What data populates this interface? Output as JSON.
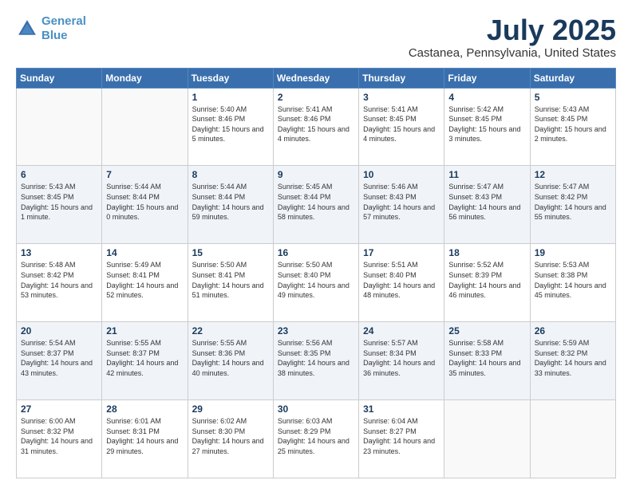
{
  "header": {
    "logo_line1": "General",
    "logo_line2": "Blue",
    "month": "July 2025",
    "location": "Castanea, Pennsylvania, United States"
  },
  "days_of_week": [
    "Sunday",
    "Monday",
    "Tuesday",
    "Wednesday",
    "Thursday",
    "Friday",
    "Saturday"
  ],
  "weeks": [
    [
      {
        "day": "",
        "empty": true
      },
      {
        "day": "",
        "empty": true
      },
      {
        "day": "1",
        "sunrise": "Sunrise: 5:40 AM",
        "sunset": "Sunset: 8:46 PM",
        "daylight": "Daylight: 15 hours and 5 minutes."
      },
      {
        "day": "2",
        "sunrise": "Sunrise: 5:41 AM",
        "sunset": "Sunset: 8:46 PM",
        "daylight": "Daylight: 15 hours and 4 minutes."
      },
      {
        "day": "3",
        "sunrise": "Sunrise: 5:41 AM",
        "sunset": "Sunset: 8:45 PM",
        "daylight": "Daylight: 15 hours and 4 minutes."
      },
      {
        "day": "4",
        "sunrise": "Sunrise: 5:42 AM",
        "sunset": "Sunset: 8:45 PM",
        "daylight": "Daylight: 15 hours and 3 minutes."
      },
      {
        "day": "5",
        "sunrise": "Sunrise: 5:43 AM",
        "sunset": "Sunset: 8:45 PM",
        "daylight": "Daylight: 15 hours and 2 minutes."
      }
    ],
    [
      {
        "day": "6",
        "sunrise": "Sunrise: 5:43 AM",
        "sunset": "Sunset: 8:45 PM",
        "daylight": "Daylight: 15 hours and 1 minute."
      },
      {
        "day": "7",
        "sunrise": "Sunrise: 5:44 AM",
        "sunset": "Sunset: 8:44 PM",
        "daylight": "Daylight: 15 hours and 0 minutes."
      },
      {
        "day": "8",
        "sunrise": "Sunrise: 5:44 AM",
        "sunset": "Sunset: 8:44 PM",
        "daylight": "Daylight: 14 hours and 59 minutes."
      },
      {
        "day": "9",
        "sunrise": "Sunrise: 5:45 AM",
        "sunset": "Sunset: 8:44 PM",
        "daylight": "Daylight: 14 hours and 58 minutes."
      },
      {
        "day": "10",
        "sunrise": "Sunrise: 5:46 AM",
        "sunset": "Sunset: 8:43 PM",
        "daylight": "Daylight: 14 hours and 57 minutes."
      },
      {
        "day": "11",
        "sunrise": "Sunrise: 5:47 AM",
        "sunset": "Sunset: 8:43 PM",
        "daylight": "Daylight: 14 hours and 56 minutes."
      },
      {
        "day": "12",
        "sunrise": "Sunrise: 5:47 AM",
        "sunset": "Sunset: 8:42 PM",
        "daylight": "Daylight: 14 hours and 55 minutes."
      }
    ],
    [
      {
        "day": "13",
        "sunrise": "Sunrise: 5:48 AM",
        "sunset": "Sunset: 8:42 PM",
        "daylight": "Daylight: 14 hours and 53 minutes."
      },
      {
        "day": "14",
        "sunrise": "Sunrise: 5:49 AM",
        "sunset": "Sunset: 8:41 PM",
        "daylight": "Daylight: 14 hours and 52 minutes."
      },
      {
        "day": "15",
        "sunrise": "Sunrise: 5:50 AM",
        "sunset": "Sunset: 8:41 PM",
        "daylight": "Daylight: 14 hours and 51 minutes."
      },
      {
        "day": "16",
        "sunrise": "Sunrise: 5:50 AM",
        "sunset": "Sunset: 8:40 PM",
        "daylight": "Daylight: 14 hours and 49 minutes."
      },
      {
        "day": "17",
        "sunrise": "Sunrise: 5:51 AM",
        "sunset": "Sunset: 8:40 PM",
        "daylight": "Daylight: 14 hours and 48 minutes."
      },
      {
        "day": "18",
        "sunrise": "Sunrise: 5:52 AM",
        "sunset": "Sunset: 8:39 PM",
        "daylight": "Daylight: 14 hours and 46 minutes."
      },
      {
        "day": "19",
        "sunrise": "Sunrise: 5:53 AM",
        "sunset": "Sunset: 8:38 PM",
        "daylight": "Daylight: 14 hours and 45 minutes."
      }
    ],
    [
      {
        "day": "20",
        "sunrise": "Sunrise: 5:54 AM",
        "sunset": "Sunset: 8:37 PM",
        "daylight": "Daylight: 14 hours and 43 minutes."
      },
      {
        "day": "21",
        "sunrise": "Sunrise: 5:55 AM",
        "sunset": "Sunset: 8:37 PM",
        "daylight": "Daylight: 14 hours and 42 minutes."
      },
      {
        "day": "22",
        "sunrise": "Sunrise: 5:55 AM",
        "sunset": "Sunset: 8:36 PM",
        "daylight": "Daylight: 14 hours and 40 minutes."
      },
      {
        "day": "23",
        "sunrise": "Sunrise: 5:56 AM",
        "sunset": "Sunset: 8:35 PM",
        "daylight": "Daylight: 14 hours and 38 minutes."
      },
      {
        "day": "24",
        "sunrise": "Sunrise: 5:57 AM",
        "sunset": "Sunset: 8:34 PM",
        "daylight": "Daylight: 14 hours and 36 minutes."
      },
      {
        "day": "25",
        "sunrise": "Sunrise: 5:58 AM",
        "sunset": "Sunset: 8:33 PM",
        "daylight": "Daylight: 14 hours and 35 minutes."
      },
      {
        "day": "26",
        "sunrise": "Sunrise: 5:59 AM",
        "sunset": "Sunset: 8:32 PM",
        "daylight": "Daylight: 14 hours and 33 minutes."
      }
    ],
    [
      {
        "day": "27",
        "sunrise": "Sunrise: 6:00 AM",
        "sunset": "Sunset: 8:32 PM",
        "daylight": "Daylight: 14 hours and 31 minutes."
      },
      {
        "day": "28",
        "sunrise": "Sunrise: 6:01 AM",
        "sunset": "Sunset: 8:31 PM",
        "daylight": "Daylight: 14 hours and 29 minutes."
      },
      {
        "day": "29",
        "sunrise": "Sunrise: 6:02 AM",
        "sunset": "Sunset: 8:30 PM",
        "daylight": "Daylight: 14 hours and 27 minutes."
      },
      {
        "day": "30",
        "sunrise": "Sunrise: 6:03 AM",
        "sunset": "Sunset: 8:29 PM",
        "daylight": "Daylight: 14 hours and 25 minutes."
      },
      {
        "day": "31",
        "sunrise": "Sunrise: 6:04 AM",
        "sunset": "Sunset: 8:27 PM",
        "daylight": "Daylight: 14 hours and 23 minutes."
      },
      {
        "day": "",
        "empty": true
      },
      {
        "day": "",
        "empty": true
      }
    ]
  ]
}
